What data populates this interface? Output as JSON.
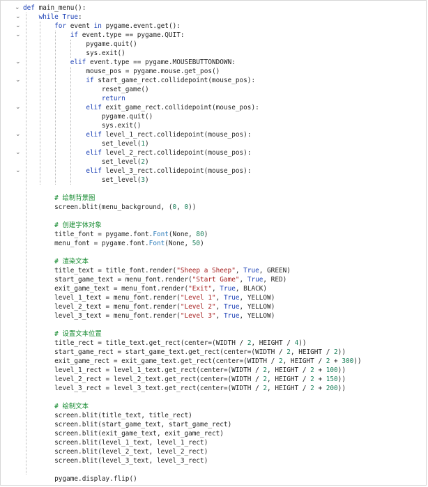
{
  "editor": {
    "language": "python",
    "lines": [
      "def main_menu():",
      "    while True:",
      "        for event in pygame.event.get():",
      "            if event.type == pygame.QUIT:",
      "                pygame.quit()",
      "                sys.exit()",
      "            elif event.type == pygame.MOUSEBUTTONDOWN:",
      "                mouse_pos = pygame.mouse.get_pos()",
      "                if start_game_rect.collidepoint(mouse_pos):",
      "                    reset_game()",
      "                    return",
      "                elif exit_game_rect.collidepoint(mouse_pos):",
      "                    pygame.quit()",
      "                    sys.exit()",
      "                elif level_1_rect.collidepoint(mouse_pos):",
      "                    set_level(1)",
      "                elif level_2_rect.collidepoint(mouse_pos):",
      "                    set_level(2)",
      "                elif level_3_rect.collidepoint(mouse_pos):",
      "                    set_level(3)",
      "",
      "        # 绘制背景图",
      "        screen.blit(menu_background, (0, 0))",
      "",
      "        # 创建字体对象",
      "        title_font = pygame.font.Font(None, 80)",
      "        menu_font = pygame.font.Font(None, 50)",
      "",
      "        # 渲染文本",
      "        title_text = title_font.render(\"Sheep a Sheep\", True, GREEN)",
      "        start_game_text = menu_font.render(\"Start Game\", True, RED)",
      "        exit_game_text = menu_font.render(\"Exit\", True, BLACK)",
      "        level_1_text = menu_font.render(\"Level 1\", True, YELLOW)",
      "        level_2_text = menu_font.render(\"Level 2\", True, YELLOW)",
      "        level_3_text = menu_font.render(\"Level 3\", True, YELLOW)",
      "",
      "        # 设置文本位置",
      "        title_rect = title_text.get_rect(center=(WIDTH / 2, HEIGHT / 4))",
      "        start_game_rect = start_game_text.get_rect(center=(WIDTH / 2, HEIGHT / 2))",
      "        exit_game_rect = exit_game_text.get_rect(center=(WIDTH / 2, HEIGHT / 2 + 300))",
      "        level_1_rect = level_1_text.get_rect(center=(WIDTH / 2, HEIGHT / 2 + 100))",
      "        level_2_rect = level_2_text.get_rect(center=(WIDTH / 2, HEIGHT / 2 + 150))",
      "        level_3_rect = level_3_text.get_rect(center=(WIDTH / 2, HEIGHT / 2 + 200))",
      "",
      "        # 绘制文本",
      "        screen.blit(title_text, title_rect)",
      "        screen.blit(start_game_text, start_game_rect)",
      "        screen.blit(exit_game_text, exit_game_rect)",
      "        screen.blit(level_1_text, level_1_rect)",
      "        screen.blit(level_2_text, level_2_rect)",
      "        screen.blit(level_3_text, level_3_rect)",
      "",
      "        pygame.display.flip()"
    ],
    "colors": {
      "keyword": "#1a3fb5",
      "builtin": "#6f42c1",
      "string": "#a51d1d",
      "number": "#1a7f5a",
      "comment": "#148a2f",
      "class_name": "#2b7bb9"
    },
    "fold_icon": "chevron-down-icon"
  }
}
